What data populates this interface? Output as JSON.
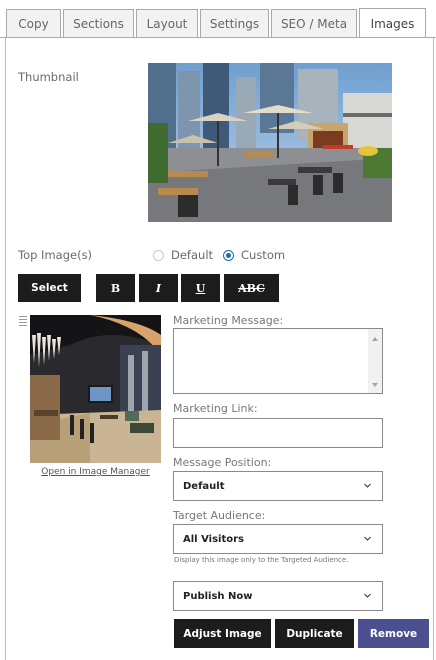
{
  "tabs": [
    {
      "label": "Copy"
    },
    {
      "label": "Sections"
    },
    {
      "label": "Layout"
    },
    {
      "label": "Settings"
    },
    {
      "label": "SEO / Meta"
    },
    {
      "label": "Images",
      "active": true
    }
  ],
  "thumbnail": {
    "label": "Thumbnail"
  },
  "top_images": {
    "label": "Top Image(s)",
    "options": [
      "Default",
      "Custom"
    ],
    "selected": "Custom"
  },
  "toolbar": {
    "select_label": "Select",
    "bold_label": "B",
    "italic_label": "I",
    "underline_label": "U",
    "strike_label": "ABC"
  },
  "image_item": {
    "open_link": "Open in Image Manager",
    "marketing_message_label": "Marketing Message:",
    "marketing_message_value": "",
    "marketing_link_label": "Marketing Link:",
    "marketing_link_value": "",
    "message_position_label": "Message Position:",
    "message_position_value": "Default",
    "target_audience_label": "Target Audience:",
    "target_audience_value": "All Visitors",
    "target_audience_help": "Display this image only to the Targeted Audience.",
    "publish_value": "Publish Now",
    "adjust_label": "Adjust Image",
    "duplicate_label": "Duplicate",
    "remove_label": "Remove"
  },
  "colors": {
    "button_dark": "#1c1c1c",
    "remove_button": "#4b4f8f",
    "radio_selected": "#1d6e9e"
  }
}
